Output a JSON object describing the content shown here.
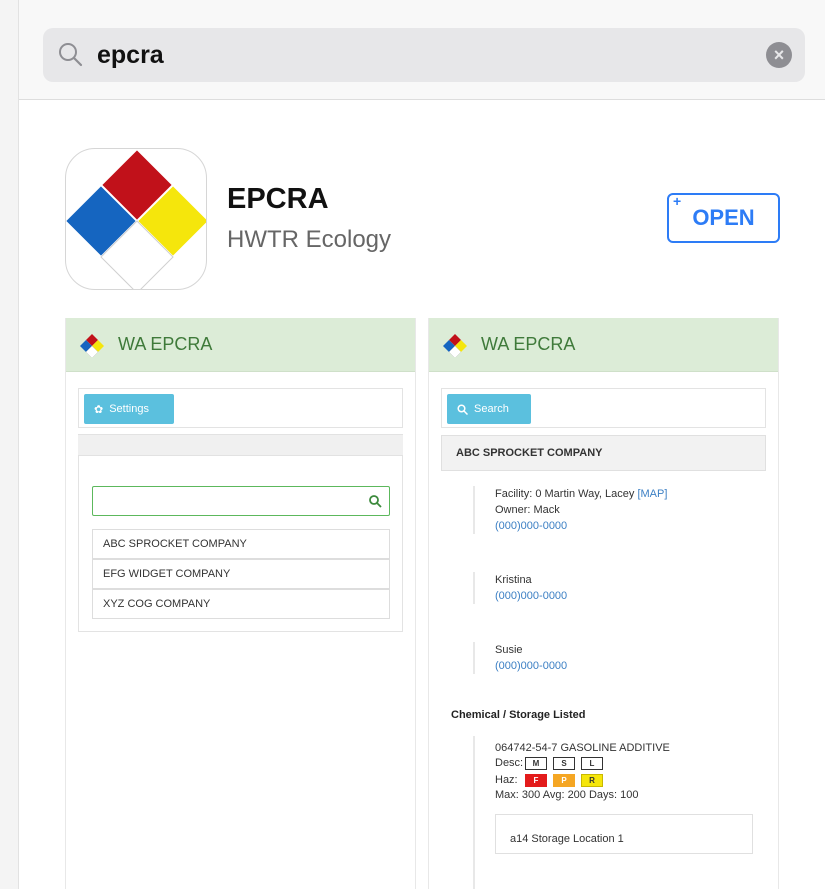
{
  "search": {
    "query": "epcra",
    "clear_symbol": "×"
  },
  "app": {
    "name": "EPCRA",
    "developer": "HWTR Ecology",
    "open_label": "OPEN",
    "open_plus": "+"
  },
  "colors": {
    "accent": "#2d7cf6",
    "header_bg": "#dcecd7",
    "header_text": "#3f7a3a",
    "button_blue": "#5bc0de",
    "nfpa_red": "#c1111a",
    "nfpa_blue": "#1565c0",
    "nfpa_yellow": "#f5e60c"
  },
  "screenshot_left": {
    "title": "WA EPCRA",
    "settings_label": "Settings",
    "companies": [
      "ABC SPROCKET COMPANY",
      "EFG WIDGET COMPANY",
      "XYZ COG COMPANY"
    ]
  },
  "screenshot_right": {
    "title": "WA EPCRA",
    "search_label": "Search",
    "company": "ABC SPROCKET COMPANY",
    "facility": "Facility: 0 Martin Way, Lacey",
    "map_link": "[MAP]",
    "owner": "Owner: Mack",
    "owner_phone": "(000)000-0000",
    "contact1_name": "Kristina",
    "contact1_phone": "(000)000-0000",
    "contact2_name": "Susie",
    "contact2_phone": "(000)000-0000",
    "section_title": "Chemical / Storage Listed",
    "chemical": "064742-54-7 GASOLINE ADDITIVE",
    "desc_label": "Desc:",
    "desc_codes": [
      "M",
      "S",
      "L"
    ],
    "haz_label": "Haz:",
    "haz_codes": [
      "F",
      "P",
      "R"
    ],
    "max_line": "Max: 300 Avg: 200 Days: 100",
    "storage": "a14   Storage Location 1"
  }
}
